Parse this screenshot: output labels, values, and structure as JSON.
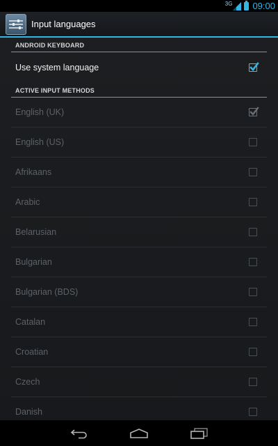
{
  "status_bar": {
    "network": "3G",
    "time": "09:00"
  },
  "action_bar": {
    "title": "Input languages",
    "icon": "settings-sliders-icon"
  },
  "sections": {
    "keyboard_header": "ANDROID KEYBOARD",
    "use_system_language": {
      "label": "Use system language",
      "checked": true
    },
    "methods_header": "ACTIVE INPUT METHODS"
  },
  "languages": [
    {
      "label": "English (UK)",
      "checked": true
    },
    {
      "label": "English (US)",
      "checked": false
    },
    {
      "label": "Afrikaans",
      "checked": false
    },
    {
      "label": "Arabic",
      "checked": false
    },
    {
      "label": "Belarusian",
      "checked": false
    },
    {
      "label": "Bulgarian",
      "checked": false
    },
    {
      "label": "Bulgarian (BDS)",
      "checked": false
    },
    {
      "label": "Catalan",
      "checked": false
    },
    {
      "label": "Croatian",
      "checked": false
    },
    {
      "label": "Czech",
      "checked": false
    },
    {
      "label": "Danish",
      "checked": false
    }
  ],
  "nav_bar": {
    "buttons": [
      "back-icon",
      "home-icon",
      "recent-apps-icon"
    ]
  },
  "colors": {
    "accent": "#33b5e5",
    "disabled_text": "#5d6266",
    "background": "#1c1e21"
  }
}
